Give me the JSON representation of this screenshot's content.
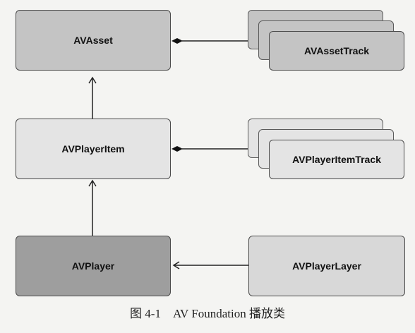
{
  "nodes": {
    "avasset": {
      "label": "AVAsset",
      "fill": "#c4c4c4"
    },
    "avassettrack": {
      "label": "AVAssetTrack",
      "fill": "#c4c4c4"
    },
    "avplayeritem": {
      "label": "AVPlayerItem",
      "fill": "#e4e4e4"
    },
    "avplayeritemtrack": {
      "label": "AVPlayerItemTrack",
      "fill": "#e4e4e4"
    },
    "avplayer": {
      "label": "AVPlayer",
      "fill": "#9e9e9e"
    },
    "avplayerlayer": {
      "label": "AVPlayerLayer",
      "fill": "#d8d8d8"
    }
  },
  "caption": "图 4-1    AV Foundation 播放类"
}
